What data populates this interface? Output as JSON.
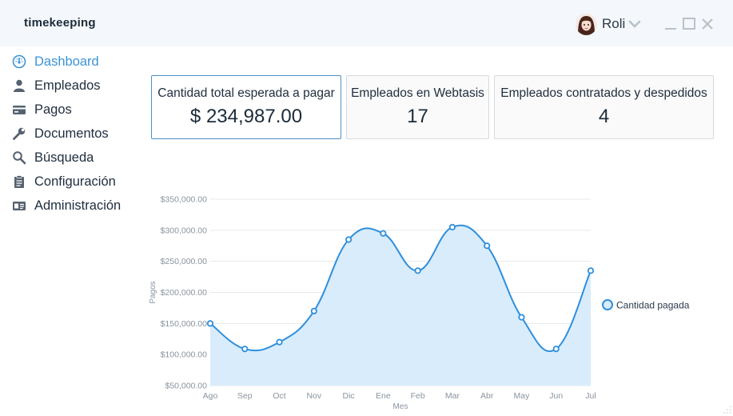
{
  "app": {
    "title": "timekeeping"
  },
  "user": {
    "name": "Roli"
  },
  "sidebar": {
    "items": [
      {
        "label": "Dashboard",
        "icon": "dashboard-icon",
        "active": true
      },
      {
        "label": "Empleados",
        "icon": "user-icon",
        "active": false
      },
      {
        "label": "Pagos",
        "icon": "credit-card-icon",
        "active": false
      },
      {
        "label": "Documentos",
        "icon": "wrench-icon",
        "active": false
      },
      {
        "label": "Búsqueda",
        "icon": "search-icon",
        "active": false
      },
      {
        "label": "Configuración",
        "icon": "clipboard-icon",
        "active": false
      },
      {
        "label": "Administración",
        "icon": "id-card-icon",
        "active": false
      }
    ]
  },
  "cards": [
    {
      "title": "Cantidad total esperada a pagar",
      "value": "$ 234,987.00"
    },
    {
      "title": "Empleados en Webtasis",
      "value": "17"
    },
    {
      "title": "Empleados contratados y despedidos",
      "value": "4"
    }
  ],
  "colors": {
    "accent": "#3c94d4",
    "line": "#2f8fdc",
    "fill": "#d9ecfb",
    "card_border_selected": "#4a90c4"
  },
  "chart_data": {
    "type": "area",
    "xlabel": "Mes",
    "ylabel": "Pagos",
    "categories": [
      "Ago",
      "Sep",
      "Oct",
      "Nov",
      "Dic",
      "Ene",
      "Feb",
      "Mar",
      "Abr",
      "May",
      "Jun",
      "Jul"
    ],
    "series": [
      {
        "name": "Cantidad pagada",
        "values": [
          150000,
          109000,
          120000,
          170000,
          285000,
          295000,
          235000,
          305000,
          275000,
          160000,
          109000,
          235000
        ]
      }
    ],
    "ylim": [
      50000,
      350000
    ],
    "yticks": [
      "$50,000.00",
      "$100,000.00",
      "$150,000.00",
      "$200,000.00",
      "$250,000.00",
      "$300,000.00",
      "$350,000.00"
    ],
    "grid": true,
    "legend": "right"
  }
}
